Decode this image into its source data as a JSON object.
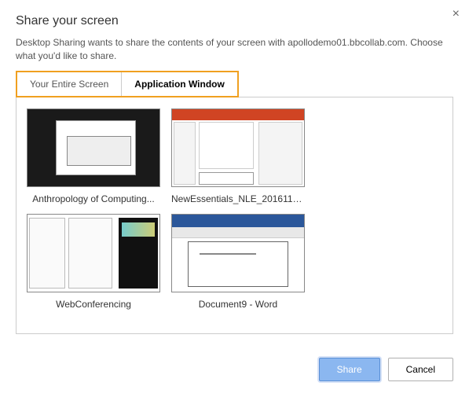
{
  "dialog": {
    "title": "Share your screen",
    "description": "Desktop Sharing wants to share the contents of your screen with apollodemo01.bbcollab.com. Choose what you'd like to share."
  },
  "tabs": {
    "entire_screen": "Your Entire Screen",
    "application_window": "Application Window"
  },
  "windows": [
    {
      "label": "Anthropology of Computing..."
    },
    {
      "label": "NewEssentials_NLE_2016110..."
    },
    {
      "label": "WebConferencing"
    },
    {
      "label": "Document9 - Word"
    }
  ],
  "buttons": {
    "share": "Share",
    "cancel": "Cancel",
    "close": "×"
  }
}
